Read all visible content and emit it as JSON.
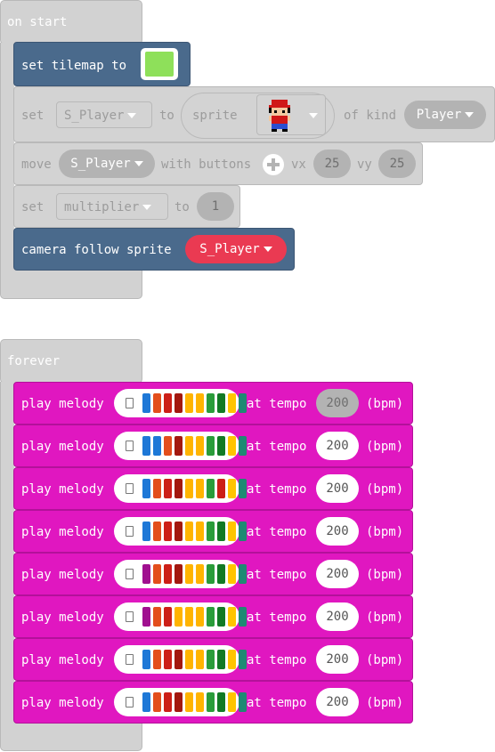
{
  "on_start": {
    "label": "on start",
    "set_tilemap": {
      "label": "set tilemap to",
      "tilemap_color": "#8ee05a"
    },
    "set_sprite": {
      "set": "set",
      "variable": "S_Player",
      "to": "to",
      "sprite": "sprite",
      "of_kind": "of kind",
      "kind": "Player"
    },
    "move": {
      "label": "move",
      "variable": "S_Player",
      "with_buttons": "with buttons",
      "vx_label": "vx",
      "vx": "25",
      "vy_label": "vy",
      "vy": "25"
    },
    "set_multiplier": {
      "set": "set",
      "variable": "multiplier",
      "to": "to",
      "value": "1"
    },
    "camera": {
      "label": "camera follow sprite",
      "variable": "S_Player",
      "color": "#ea3a52"
    }
  },
  "forever": {
    "label": "forever",
    "melodies": [
      {
        "play": "play melody",
        "at_tempo": "at tempo",
        "tempo": "200",
        "bpm": "(bpm)",
        "tempo_style": "grey",
        "notes": [
          "#1e78d7",
          "#e34e1c",
          "#cc1f17",
          "#a3180f",
          "#ffb400",
          "#ffb400",
          "#2a9c3a",
          "#127a25",
          "#ffc400",
          "#1e8a73"
        ]
      },
      {
        "play": "play melody",
        "at_tempo": "at tempo",
        "tempo": "200",
        "bpm": "(bpm)",
        "tempo_style": "white",
        "notes": [
          "#1e78d7",
          "#1e78d7",
          "#e34e1c",
          "#a3180f",
          "#ffb400",
          "#ffb400",
          "#2a9c3a",
          "#127a25",
          "#ffc400",
          "#1e8a73"
        ]
      },
      {
        "play": "play melody",
        "at_tempo": "at tempo",
        "tempo": "200",
        "bpm": "(bpm)",
        "tempo_style": "white",
        "notes": [
          "#1e78d7",
          "#e34e1c",
          "#cc1f17",
          "#a3180f",
          "#ffb400",
          "#ffb400",
          "#2a9c3a",
          "#cc1f17",
          "#ffc400",
          "#1e8a73"
        ]
      },
      {
        "play": "play melody",
        "at_tempo": "at tempo",
        "tempo": "200",
        "bpm": "(bpm)",
        "tempo_style": "white",
        "notes": [
          "#1e78d7",
          "#e34e1c",
          "#cc1f17",
          "#a3180f",
          "#ffb400",
          "#ffb400",
          "#2a9c3a",
          "#127a25",
          "#ffc400",
          "#1e8a73"
        ]
      },
      {
        "play": "play melody",
        "at_tempo": "at tempo",
        "tempo": "200",
        "bpm": "(bpm)",
        "tempo_style": "white",
        "notes": [
          "#a0108f",
          "#e34e1c",
          "#cc1f17",
          "#a3180f",
          "#ffb400",
          "#ffb400",
          "#2a9c3a",
          "#127a25",
          "#ffc400",
          "#1e8a73"
        ]
      },
      {
        "play": "play melody",
        "at_tempo": "at tempo",
        "tempo": "200",
        "bpm": "(bpm)",
        "tempo_style": "white",
        "notes": [
          "#a0108f",
          "#e34e1c",
          "#cc1f17",
          "#ffb400",
          "#ffb400",
          "#ffb400",
          "#2a9c3a",
          "#127a25",
          "#ffc400",
          "#1e8a73"
        ]
      },
      {
        "play": "play melody",
        "at_tempo": "at tempo",
        "tempo": "200",
        "bpm": "(bpm)",
        "tempo_style": "white",
        "notes": [
          "#1e78d7",
          "#e34e1c",
          "#cc1f17",
          "#a3180f",
          "#ffb400",
          "#ffb400",
          "#2a9c3a",
          "#127a25",
          "#ffc400",
          "#1e8a73"
        ]
      },
      {
        "play": "play melody",
        "at_tempo": "at tempo",
        "tempo": "200",
        "bpm": "(bpm)",
        "tempo_style": "white",
        "notes": [
          "#1e78d7",
          "#e34e1c",
          "#cc1f17",
          "#a3180f",
          "#ffb400",
          "#ffb400",
          "#2a9c3a",
          "#127a25",
          "#ffc400",
          "#1e8a73"
        ]
      }
    ]
  }
}
